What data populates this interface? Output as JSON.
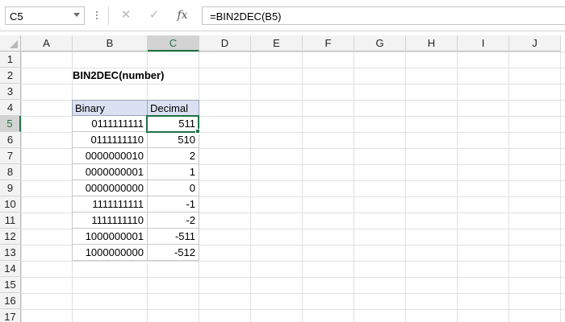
{
  "formula_bar": {
    "name_box": "C5",
    "cancel_icon": "✕",
    "enter_icon": "✓",
    "fx_label": "fx",
    "formula": "=BIN2DEC(B5)"
  },
  "columns": [
    "A",
    "B",
    "C",
    "D",
    "E",
    "F",
    "G",
    "H",
    "I",
    "J"
  ],
  "rows": [
    "1",
    "2",
    "3",
    "4",
    "5",
    "6",
    "7",
    "8",
    "9",
    "10",
    "11",
    "12",
    "13",
    "14",
    "15",
    "16",
    "17"
  ],
  "active_column": "C",
  "active_row": "5",
  "sheet": {
    "title": "BIN2DEC(number)",
    "table_headers": {
      "binary": "Binary",
      "decimal": "Decimal"
    },
    "table_rows": [
      {
        "binary": "0111111111",
        "decimal": "511"
      },
      {
        "binary": "0111111110",
        "decimal": "510"
      },
      {
        "binary": "0000000010",
        "decimal": "2"
      },
      {
        "binary": "0000000001",
        "decimal": "1"
      },
      {
        "binary": "0000000000",
        "decimal": "0"
      },
      {
        "binary": "1111111111",
        "decimal": "-1"
      },
      {
        "binary": "1111111110",
        "decimal": "-2"
      },
      {
        "binary": "1000000001",
        "decimal": "-511"
      },
      {
        "binary": "1000000000",
        "decimal": "-512"
      }
    ]
  },
  "colors": {
    "accent": "#217346",
    "header_fill": "#d9e1f2"
  }
}
